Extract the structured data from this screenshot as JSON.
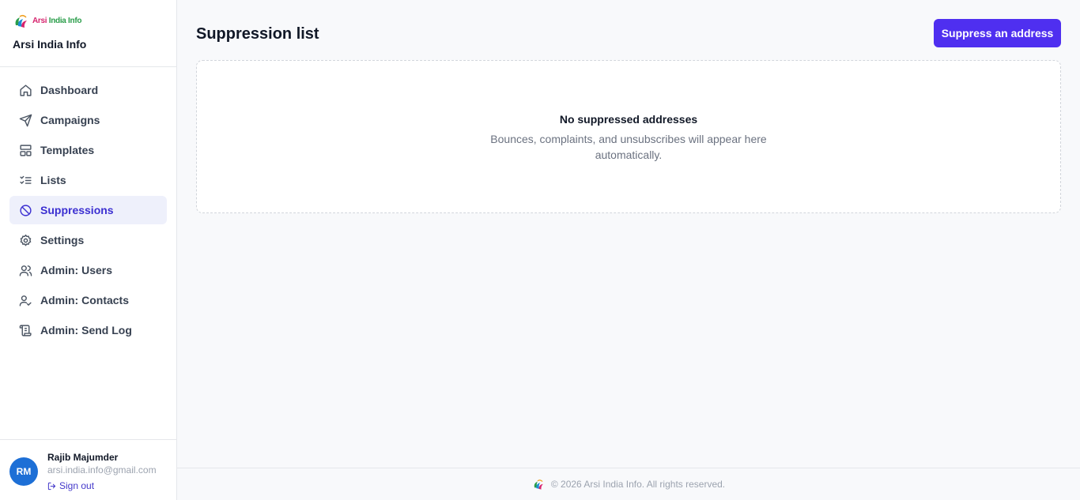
{
  "brand": {
    "logo_text_a": "Arsi ",
    "logo_text_b": "India Info",
    "name": "Arsi India Info"
  },
  "nav": {
    "items": [
      {
        "label": "Dashboard",
        "icon": "home-icon"
      },
      {
        "label": "Campaigns",
        "icon": "send-icon"
      },
      {
        "label": "Templates",
        "icon": "layout-icon"
      },
      {
        "label": "Lists",
        "icon": "list-checks-icon"
      },
      {
        "label": "Suppressions",
        "icon": "ban-icon",
        "active": true
      },
      {
        "label": "Settings",
        "icon": "gear-icon"
      },
      {
        "label": "Admin: Users",
        "icon": "users-icon"
      },
      {
        "label": "Admin: Contacts",
        "icon": "user-check-icon"
      },
      {
        "label": "Admin: Send Log",
        "icon": "scroll-icon"
      }
    ]
  },
  "user": {
    "initials": "RM",
    "name": "Rajib Majumder",
    "email": "arsi.india.info@gmail.com",
    "signout_label": "Sign out"
  },
  "header": {
    "title": "Suppression list",
    "action_label": "Suppress an address"
  },
  "empty_state": {
    "title": "No suppressed addresses",
    "description": "Bounces, complaints, and unsubscribes will appear here automatically."
  },
  "footer": {
    "text": "© 2026 Arsi India Info. All rights reserved."
  },
  "colors": {
    "accent": "#4f2ff0",
    "active_nav_bg": "#eef0fb",
    "active_nav_text": "#3b2fd1",
    "avatar_bg": "#1d6fd6"
  }
}
